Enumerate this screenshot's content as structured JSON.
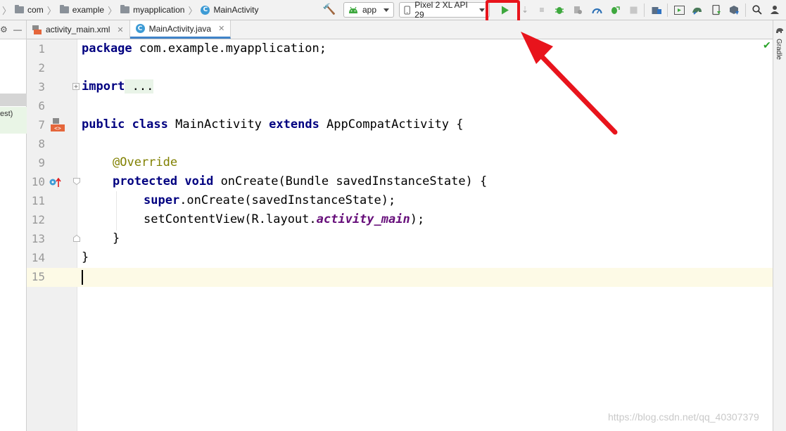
{
  "breadcrumb": {
    "items": [
      "com",
      "example",
      "myapplication",
      "MainActivity"
    ]
  },
  "toolbar": {
    "config": "app",
    "device": "Pixel 2 XL API 29",
    "colors": {
      "run": "#3ea83e",
      "highlight": "#e8141c"
    }
  },
  "left_panel": {
    "minimize": "—",
    "partial_text": "est)"
  },
  "tabs": [
    {
      "label": "activity_main.xml",
      "close": "✕",
      "active": false
    },
    {
      "label": "MainActivity.java",
      "close": "✕",
      "active": true
    }
  ],
  "right_strip": {
    "label": "Gradle"
  },
  "editor": {
    "line_numbers": [
      "1",
      "2",
      "3",
      "6",
      "7",
      "8",
      "9",
      "10",
      "11",
      "12",
      "13",
      "14",
      "15"
    ],
    "lines": {
      "l1_kw": "package",
      "l1_rest": " com.example.myapplication;",
      "l3_kw": "import",
      "l3_fold": " ...",
      "l7_kw1": "public",
      "l7_kw2": "class",
      "l7_mid": " MainActivity ",
      "l7_kw3": "extends",
      "l7_rest": " AppCompatActivity {",
      "l9_ann": "@Override",
      "l10_kw1": "protected",
      "l10_kw2": "void",
      "l10_rest": " onCreate(Bundle savedInstanceState) {",
      "l11_kw": "super",
      "l11_rest": ".onCreate(savedInstanceState);",
      "l12_pre": "setContentView(R.layout.",
      "l12_fld": "activity_main",
      "l12_post": ");",
      "l13": "}",
      "l14": "}"
    }
  },
  "watermark": "https://blog.csdn.net/qq_40307379"
}
